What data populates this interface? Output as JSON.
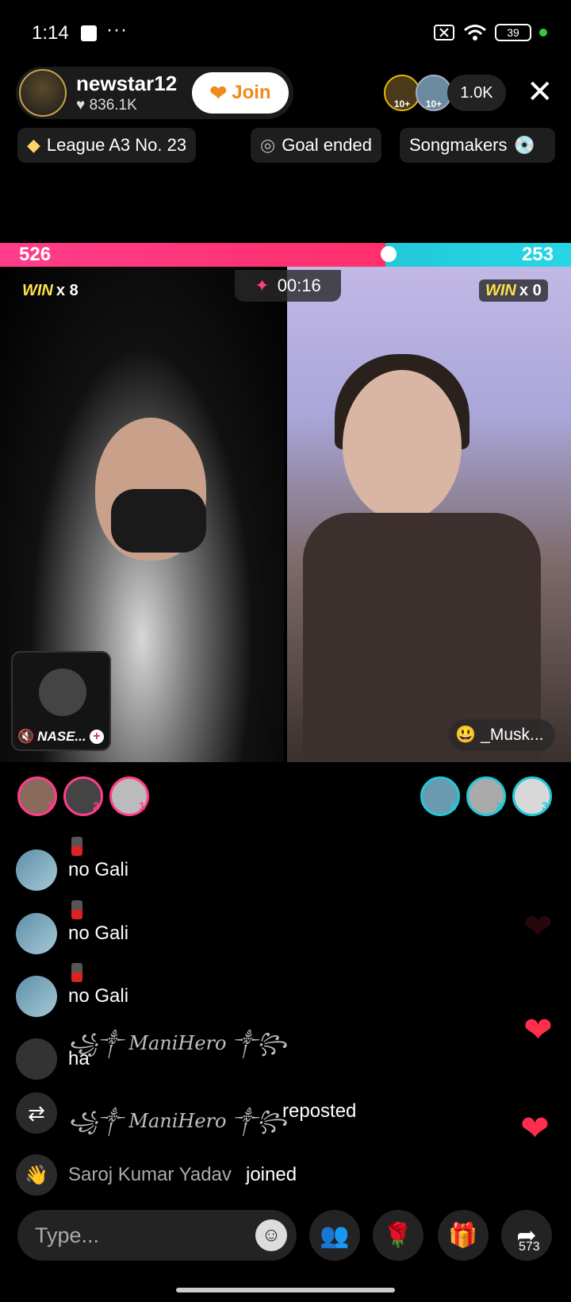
{
  "status": {
    "time": "1:14",
    "dots": "···",
    "battery": "39"
  },
  "host": {
    "name": "newstar12",
    "likes": "836.1K",
    "join_label": "Join"
  },
  "viewers": {
    "count": "1.0K",
    "badges": [
      "10+",
      "10+"
    ]
  },
  "chips": {
    "league": "League A3 No. 23",
    "goal": "Goal ended",
    "songmakers": "Songmakers"
  },
  "battle": {
    "left_score": "526",
    "right_score": "253",
    "left_share": 0.675,
    "timer": "00:16",
    "left_win_word": "WIN",
    "left_win_count": "x 8",
    "right_win_word": "WIN",
    "right_win_count": "x 0",
    "guest_name": "NASE...",
    "opponent_name": "_Musk..."
  },
  "gifters": {
    "left": [
      "3",
      "2",
      "1"
    ],
    "right": [
      "1",
      "2",
      "3"
    ]
  },
  "chat": [
    {
      "type": "message",
      "text": "no Gali"
    },
    {
      "type": "message",
      "text": "no Gali"
    },
    {
      "type": "message",
      "text": "no Gali"
    },
    {
      "type": "message",
      "name": "꧁༒ ManiHero ༒꧂",
      "text": "ha"
    },
    {
      "type": "repost",
      "name": "꧁༒ ManiHero ༒꧂",
      "text": "reposted"
    },
    {
      "type": "joined",
      "name": "Saroj Kumar Yadav",
      "text": "joined"
    }
  ],
  "input": {
    "placeholder": "Type..."
  },
  "share": {
    "count": "573"
  },
  "icons": [
    "heart-icon",
    "close-icon",
    "wifi-icon",
    "battery-icon",
    "emoji-icon",
    "multi-guest-icon",
    "rose-gift-icon",
    "gift-icon",
    "share-icon",
    "repost-icon",
    "wave-icon",
    "timer-icon",
    "mute-icon"
  ],
  "colors": {
    "left_team": "#ff3d8b",
    "right_team": "#22c9d8",
    "join": "#f08a1c",
    "heart": "#ff2e4d"
  }
}
